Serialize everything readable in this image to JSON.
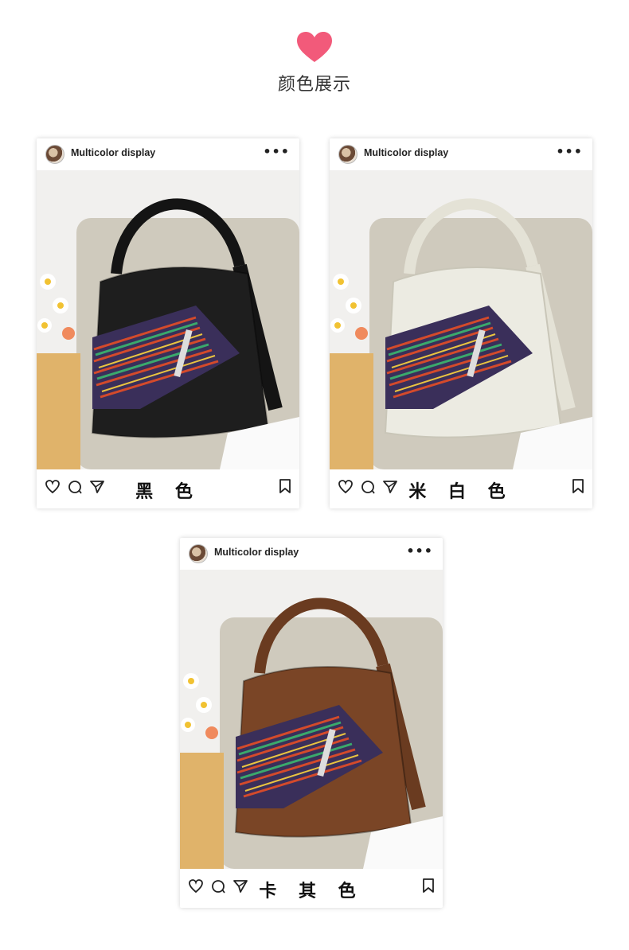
{
  "section": {
    "title": "颜色展示",
    "heart_color": "#f25a7a"
  },
  "cards": [
    {
      "handle": "Multicolor display",
      "more": "•••",
      "color_name": "黑 色",
      "bag_color": "#1e1e1e",
      "strap_color": "#141414"
    },
    {
      "handle": "Multicolor display",
      "more": "•••",
      "color_name": "米 白 色",
      "bag_color": "#ecebe2",
      "strap_color": "#e4e2d6"
    },
    {
      "handle": "Multicolor display",
      "more": "•••",
      "color_name": "卡 其 色",
      "bag_color": "#7a4526",
      "strap_color": "#6a3b20"
    }
  ],
  "icons": [
    "heart-outline-icon",
    "comment-icon",
    "send-icon",
    "bookmark-icon",
    "more-dots-icon",
    "avatar"
  ]
}
